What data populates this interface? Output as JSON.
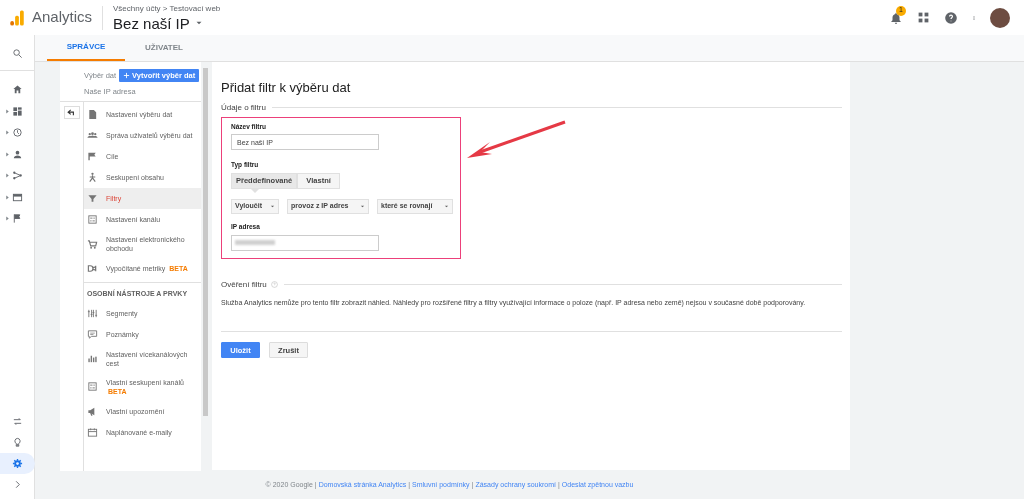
{
  "header": {
    "app_name": "Analytics",
    "breadcrumb": "Všechny účty > Testovací web",
    "view_name": "Bez naší IP",
    "notification_count": "1"
  },
  "tabs": [
    {
      "label": "SPRÁVCE",
      "selected": true
    },
    {
      "label": "UŽIVATEL",
      "selected": false
    }
  ],
  "view_column": {
    "label": "Výběr dat",
    "create_button": "Vytvořit výběr dat",
    "view_name": "Naše IP adresa"
  },
  "nav": {
    "items": [
      {
        "label": "Nastavení výběru dat",
        "selected": false
      },
      {
        "label": "Správa uživatelů výběru dat",
        "selected": false
      },
      {
        "label": "Cíle",
        "selected": false
      },
      {
        "label": "Seskupení obsahu",
        "selected": false
      },
      {
        "label": "Filtry",
        "selected": true
      },
      {
        "label": "Nastavení kanálu",
        "selected": false
      },
      {
        "label": "Nastavení elektronického obchodu",
        "selected": false
      },
      {
        "label": "Vypočítané metriky",
        "badge": "BETA",
        "selected": false
      }
    ],
    "section_title": "OSOBNÍ NÁSTROJE A PRVKY",
    "personal_items": [
      {
        "label": "Segmenty",
        "selected": false
      },
      {
        "label": "Poznámky",
        "selected": false
      },
      {
        "label": "Nastavení vícekanálových cest",
        "selected": false
      },
      {
        "label": "Vlastní seskupení kanálů",
        "badge": "BETA",
        "selected": false
      },
      {
        "label": "Vlastní upozornění",
        "selected": false
      },
      {
        "label": "Naplánované e-maily",
        "selected": false
      }
    ]
  },
  "form": {
    "title": "Přidat filtr k výběru dat",
    "section_title": "Údaje o filtru",
    "name_label": "Název filtru",
    "name_value": "Bez naší IP",
    "type_label": "Typ filtru",
    "type_options": [
      {
        "label": "Předdefinované",
        "selected": true
      },
      {
        "label": "Vlastní",
        "selected": false
      }
    ],
    "dropdowns": [
      "Vyloučit",
      "provoz z IP adres",
      "které se rovnají"
    ],
    "ip_label": "IP adresa",
    "verify_title": "Ověření filtru",
    "verify_text": "Služba Analytics nemůže pro tento filtr zobrazit náhled. Náhledy pro rozšířené filtry a filtry využívající informace o poloze (např. IP adresa nebo země) nejsou v současné době podporovány.",
    "buttons": [
      {
        "label": "Uložit",
        "kind": "primary"
      },
      {
        "label": "Zrušit",
        "kind": "secondary"
      }
    ]
  },
  "footer": {
    "copyright": "© 2020 Google",
    "separators": [
      "|",
      "|",
      "|",
      "|"
    ],
    "links": [
      "Domovská stránka Analytics",
      "Smluvní podmínky",
      "Zásady ochrany soukromí",
      "Odeslat zpětnou vazbu"
    ]
  }
}
